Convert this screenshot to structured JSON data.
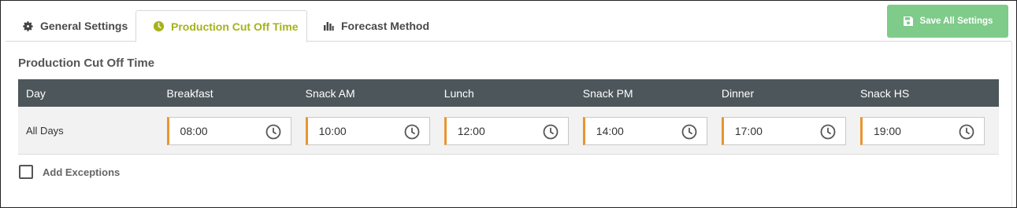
{
  "tabs": [
    {
      "label": "General Settings",
      "icon": "gear-icon"
    },
    {
      "label": "Production Cut Off Time",
      "icon": "clock-icon",
      "active": true
    },
    {
      "label": "Forecast Method",
      "icon": "bar-chart-icon"
    }
  ],
  "save_button": {
    "label": "Save All Settings",
    "icon": "save-icon"
  },
  "section": {
    "title": "Production Cut Off Time"
  },
  "table": {
    "columns": [
      "Day",
      "Breakfast",
      "Snack AM",
      "Lunch",
      "Snack PM",
      "Dinner",
      "Snack HS"
    ],
    "row": {
      "day": "All Days",
      "times": [
        "08:00",
        "10:00",
        "12:00",
        "14:00",
        "17:00",
        "19:00"
      ]
    }
  },
  "exceptions": {
    "label": "Add Exceptions",
    "checked": false
  },
  "colors": {
    "active_tab": "#a7b21c",
    "save_button": "#7fcb8a",
    "header_bg": "#4d575b",
    "field_accent": "#e8962e"
  }
}
